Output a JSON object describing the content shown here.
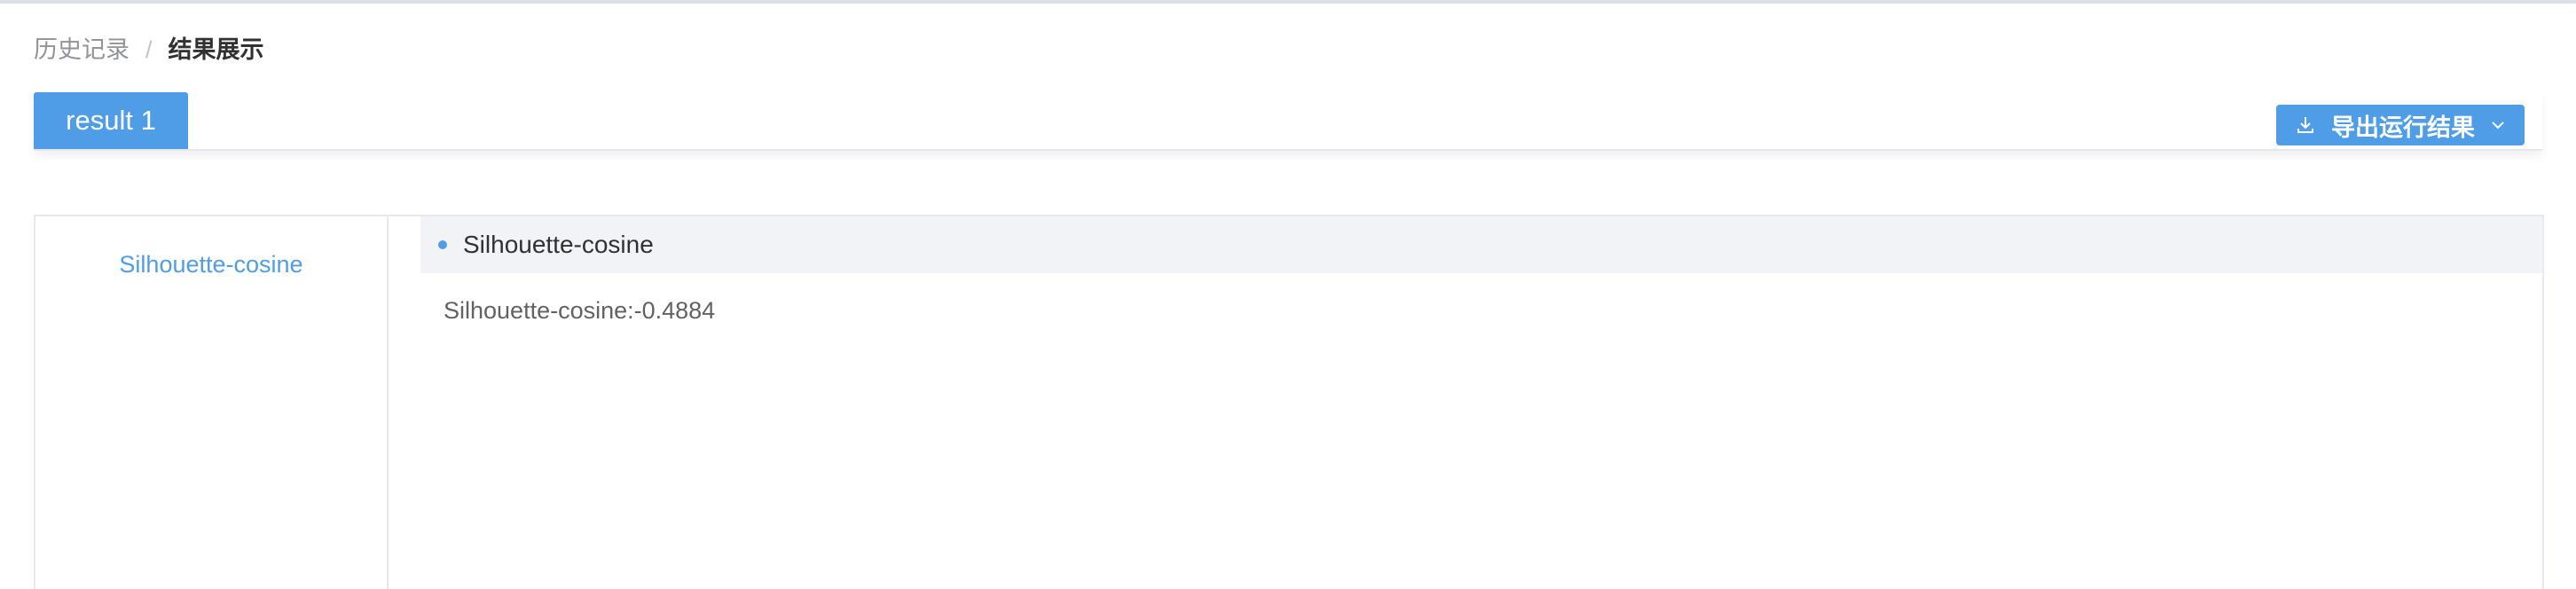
{
  "breadcrumb": {
    "items": [
      "历史记录",
      "结果展示"
    ],
    "separator": "/"
  },
  "tabs": [
    {
      "label": "result 1",
      "active": true
    }
  ],
  "toolbar": {
    "export_label": "导出运行结果",
    "export_icon": "download-icon",
    "dropdown_icon": "chevron-down-icon"
  },
  "sidebar": {
    "items": [
      {
        "label": "Silhouette-cosine",
        "active": true
      }
    ]
  },
  "content": {
    "section_title": "Silhouette-cosine",
    "metric_text": "Silhouette-cosine:-0.4884"
  },
  "colors": {
    "accent": "#4f9de6",
    "text_primary": "#303133",
    "text_secondary": "#606266",
    "text_muted": "#909399",
    "header_bg": "#f2f3f7",
    "border": "#e6e9ef"
  }
}
